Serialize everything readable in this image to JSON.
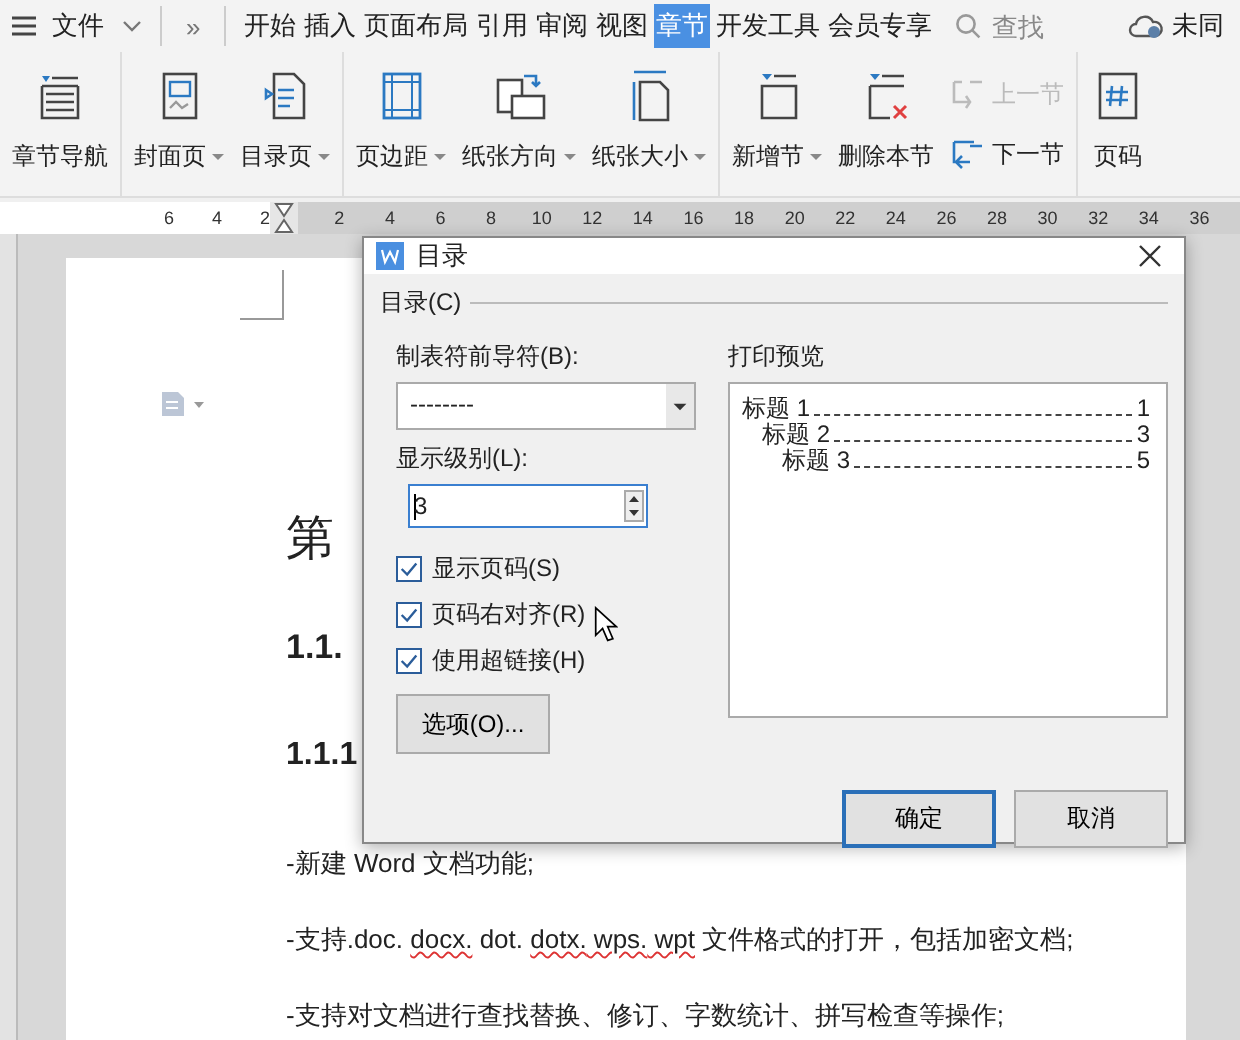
{
  "menu_bar": {
    "file_menu": "文件",
    "more": "»",
    "tabs": [
      {
        "label": "开始",
        "selected": false
      },
      {
        "label": "插入",
        "selected": false
      },
      {
        "label": "页面布局",
        "selected": false
      },
      {
        "label": "引用",
        "selected": false
      },
      {
        "label": "审阅",
        "selected": false
      },
      {
        "label": "视图",
        "selected": false
      },
      {
        "label": "章节",
        "selected": true
      },
      {
        "label": "开发工具",
        "selected": false
      },
      {
        "label": "会员专享",
        "selected": false
      }
    ],
    "search": {
      "placeholder": "查找"
    },
    "sync_status": "未同"
  },
  "ribbon": {
    "groups": [
      {
        "items": [
          {
            "kind": "large",
            "label": "章节导航",
            "dropdown": false
          }
        ]
      },
      {
        "items": [
          {
            "kind": "large",
            "label": "封面页",
            "dropdown": true
          },
          {
            "kind": "large",
            "label": "目录页",
            "dropdown": true
          }
        ]
      },
      {
        "items": [
          {
            "kind": "large",
            "label": "页边距",
            "dropdown": true
          },
          {
            "kind": "large",
            "label": "纸张方向",
            "dropdown": true
          },
          {
            "kind": "large",
            "label": "纸张大小",
            "dropdown": true
          }
        ]
      },
      {
        "items": [
          {
            "kind": "large",
            "label": "新增节",
            "dropdown": true
          },
          {
            "kind": "large",
            "label": "删除本节",
            "dropdown": false
          },
          {
            "kind": "stack",
            "entries": [
              {
                "label": "上一节",
                "disabled": true
              },
              {
                "label": "下一节",
                "disabled": false
              }
            ]
          }
        ]
      },
      {
        "items": [
          {
            "kind": "large",
            "label": "页码",
            "dropdown": false
          }
        ]
      }
    ]
  },
  "ruler": {
    "left_ticks": [
      "6",
      "4",
      "2"
    ],
    "right_ticks": [
      "2",
      "4",
      "6",
      "8",
      "10",
      "12",
      "14",
      "16",
      "18",
      "20",
      "22",
      "24",
      "26",
      "28",
      "30",
      "32",
      "34",
      "36"
    ]
  },
  "document": {
    "headings": [
      {
        "kind": "title",
        "text": "第"
      },
      {
        "kind": "h2",
        "text": "1.1."
      },
      {
        "kind": "h3",
        "text": "1.1.1"
      }
    ],
    "paragraphs": [
      [
        {
          "text": "-新建 Word 文档功能;",
          "misspelled": false
        }
      ],
      [
        {
          "text": "-支持.doc. ",
          "misspelled": false
        },
        {
          "text": "docx.",
          "misspelled": true
        },
        {
          "text": " dot. ",
          "misspelled": false
        },
        {
          "text": "dotx.",
          "misspelled": true
        },
        {
          "text": " wps.",
          "misspelled": true
        },
        {
          "text": " wpt",
          "misspelled": true
        },
        {
          "text": " 文件格式的打开，包括加密文档;",
          "misspelled": false
        }
      ],
      [
        {
          "text": "-支持对文档进行查找替换、修订、字数统计、拼写检查等操作;",
          "misspelled": false
        }
      ]
    ]
  },
  "dialog": {
    "title": "目录",
    "section": "目录(C)",
    "leader_label": "制表符前导符(B):",
    "leader_value": "--------",
    "level_label": "显示级别(L):",
    "level_value": "3",
    "checkboxes": [
      {
        "label": "显示页码(S)",
        "checked": true
      },
      {
        "label": "页码右对齐(R)",
        "checked": true
      },
      {
        "label": "使用超链接(H)",
        "checked": true
      }
    ],
    "options_button": "选项(O)...",
    "preview_label": "打印预览",
    "preview": [
      {
        "text": "标题 1",
        "page": "1",
        "children": [
          {
            "text": "标题 2",
            "page": "3",
            "children": [
              {
                "text": "标题 3",
                "page": "5"
              }
            ]
          }
        ]
      }
    ],
    "buttons": [
      {
        "label": "确定",
        "default": true
      },
      {
        "label": "取消",
        "default": false
      }
    ]
  }
}
